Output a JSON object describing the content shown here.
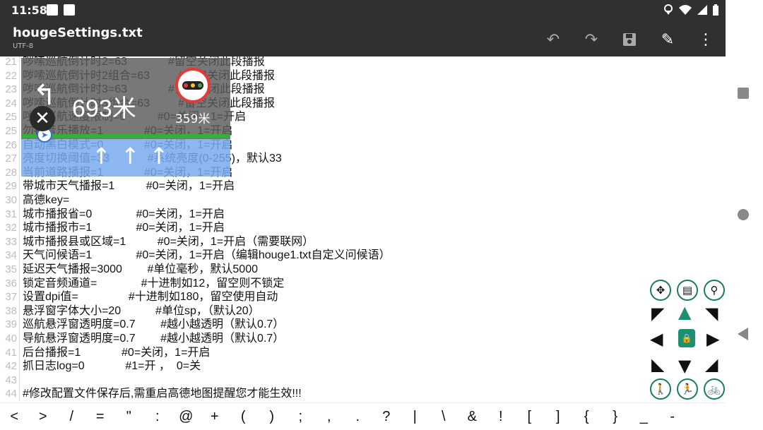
{
  "status_bar": {
    "time": "11:58"
  },
  "app_bar": {
    "title": "hougeSettings.txt",
    "encoding": "UTF-8",
    "actions": [
      "undo-icon",
      "redo-icon",
      "save-icon",
      "edit-icon",
      "more-icon"
    ]
  },
  "editor": {
    "lines": [
      {
        "num": "21",
        "text": "哕嗦巡航倒计时2=63             #留空关闭此段播报"
      },
      {
        "num": "22",
        "text": "哕嗦巡航倒计时2组合=63         #留空关闭此段播报"
      },
      {
        "num": "23",
        "text": "哕嗦巡航倒计时3=63             #留空关闭此段播报"
      },
      {
        "num": "24",
        "text": "哕嗦巡航倒计时3组合=63         #留空关闭此段播报"
      },
      {
        "num": "25",
        "text": "哕嗦巡航速度限制=0          #0=关闭，1=开启"
      },
      {
        "num": "25",
        "text": "勿扰音乐播放=1             #0=关闭，1=开启"
      },
      {
        "num": "26",
        "text": "自动黑白模式=0             #0=关闭，1=开启"
      },
      {
        "num": "27",
        "text": "亮度切换阈值=33            #系统亮度(0-255)，默认33"
      },
      {
        "num": "28",
        "text": "当前道路播报=1             #0=关闭，1=开启"
      },
      {
        "num": "29",
        "text": "带城市天气播报=1          #0=关闭，1=开启"
      },
      {
        "num": "30",
        "text": "高德key="
      },
      {
        "num": "31",
        "text": "城市播报省=0              #0=关闭，1=开启"
      },
      {
        "num": "32",
        "text": "城市播报市=1              #0=关闭，1=开启"
      },
      {
        "num": "33",
        "text": "城市播报县或区域=1          #0=关闭，1=开启（需要联网）"
      },
      {
        "num": "34",
        "text": "天气问候语=1              #0=关闭，1=开启（编辑houge1.txt自定义问候语）"
      },
      {
        "num": "35",
        "text": "延迟天气播报=3000        #单位毫秒，默认5000"
      },
      {
        "num": "36",
        "text": "锁定音频通道=              #十进制如12，留空则不锁定"
      },
      {
        "num": "37",
        "text": "设置dpi值=                #十进制如180，留空使用自动"
      },
      {
        "num": "38",
        "text": "悬浮窗字体大小=20           #单位sp，（默认20）"
      },
      {
        "num": "39",
        "text": "巡航悬浮窗透明度=0.7        #越小越透明（默认0.7）"
      },
      {
        "num": "40",
        "text": "导航悬浮窗透明度=0.7        #越小越透明（默认0.7）"
      },
      {
        "num": "41",
        "text": "后台播报=1             #0=关闭，1=开启"
      },
      {
        "num": "42",
        "text": "抓日志log=0             #1=开 ，  0=关"
      },
      {
        "num": "43",
        "text": ""
      },
      {
        "num": "44",
        "text": "#修改配置文件保存后,需重启高德地图提醒您才能生效!!!"
      }
    ]
  },
  "nav_overlay": {
    "distance": "693米",
    "light_distance": "359米",
    "lanes": [
      "↑",
      "↑",
      "↑"
    ]
  },
  "control_pad": {
    "buttons": [
      "move-icon",
      "settings-file-icon",
      "route-icon",
      "walk-icon",
      "run-icon",
      "bike-icon"
    ],
    "lock": "lock-icon"
  },
  "symbol_bar": {
    "keys": [
      "<",
      ">",
      "/",
      "=",
      "\"",
      ":",
      "@",
      "+",
      "(",
      ")",
      ";",
      ",",
      ".",
      "?",
      "|",
      "\\",
      "&",
      "!",
      "[",
      "]",
      "{",
      "}",
      "_",
      "-"
    ]
  }
}
